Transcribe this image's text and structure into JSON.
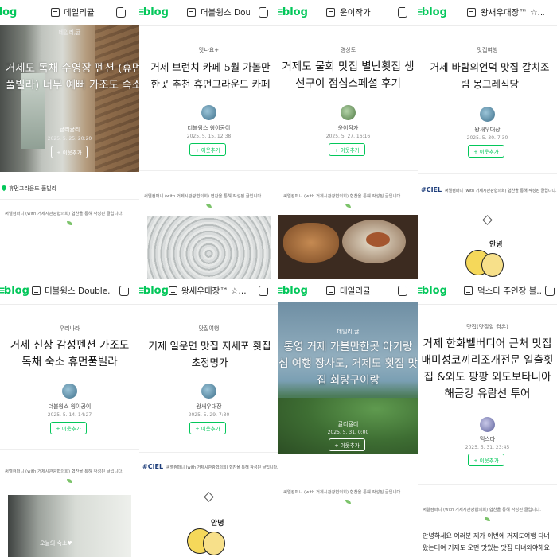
{
  "tiles": [
    {
      "blog_name": "데일리귤",
      "category": "데일리,귤",
      "title_line1": "거제도 독채 수영장 펜션 (휴먼",
      "title_line2": "풀빌라) 너무 예뻐 가조도 숙소",
      "author": "귤리귤리",
      "date": "2025. 5. 25. 20:20",
      "neighbor": "+ 이웃추가",
      "location": "휴먼그라운드 풀빌라",
      "note": "써엘컴퍼니 (with 거제시관광협의회) 협찬을 통해 작성된 글입니다."
    },
    {
      "blog_name": "더블윙스 Double...",
      "category": "맛나요+",
      "title_line1": "거제 브런치 카페 5월 가볼만",
      "title_line2": "한곳 추천 휴먼그라운드 카페",
      "author": "더블윙스 윙이공이",
      "date": "2025. 5. 15. 12:38",
      "neighbor": "+ 이웃추가",
      "note": "써엘컴퍼니 (with 거제시관광협의회) 협찬을 통해 작성된 글입니다."
    },
    {
      "blog_name": "윤이작가",
      "category": "경상도",
      "title_line1": "거제도 물회 맛집 별난횟집 생",
      "title_line2": "선구이 점심스페셜 후기",
      "author": "윤이작가",
      "date": "2025. 5. 27. 16:16",
      "neighbor": "+ 이웃추가",
      "note": "써엘컴퍼니 (with 거제시관광협의회) 협찬을 통해 작성된 글입니다."
    },
    {
      "blog_name": "왕새우대장™ ☆...",
      "category": "맛집여행",
      "title_line1": "거제 바람의언덕 맛집 갈치조",
      "title_line2": "림 몽그레식당",
      "author": "왕새우대장",
      "date": "2025. 5. 30. 7:30",
      "neighbor": "+ 이웃추가",
      "ciel": "#CIEL",
      "ciel_note": "써엘컴퍼니 (with 거제시관광협의회) 협찬을 통해 작성된 글입니다.",
      "sticker_text": "안녕"
    },
    {
      "blog_name": "더블윙스 Double...",
      "category": "우리나라",
      "title_line1": "거제 신상 감성펜션 가조도",
      "title_line2": "독채 숙소 휴먼풀빌라",
      "author": "더블윙스 윙이공이",
      "date": "2025. 5. 14. 14:27",
      "neighbor": "+ 이웃추가",
      "note": "써엘컴퍼니 (with 거제시관광협의회) 협찬을 통해 작성된 글입니다.",
      "photo_caption": "오늘의 숙소♥"
    },
    {
      "blog_name": "왕새우대장™ ☆...",
      "category": "맛집여행",
      "title_line1": "거제 일운면 맛집 지세포 횟집",
      "title_line2": "초정명가",
      "author": "왕새우대장",
      "date": "2025. 5. 29. 7:30",
      "neighbor": "+ 이웃추가",
      "ciel": "#CIEL",
      "ciel_note": "써엘컴퍼니 (with 거제시관광협의회) 협찬을 통해 작성된 글입니다.",
      "sticker_text": "안녕"
    },
    {
      "blog_name": "데일리귤",
      "category": "데일리,귤",
      "title_line1": "통영 거제 가볼만한곳 아기랑",
      "title_line2": "섬 여행 장사도, 거제도 횟집 맛",
      "title_line3": "집 회랑구이랑",
      "author": "귤리귤리",
      "date": "2025. 5. 31. 0:00",
      "neighbor": "+ 이웃추가",
      "note": "써엘컴퍼니 (with 거제시관광협의회) 협찬을 통해 작성된 글입니다."
    },
    {
      "blog_name": "먹스타 주인장 블...",
      "category": "맛집(맛잘알 컴온)",
      "title_line1": "거제 한화벨버디어 근처 맛집",
      "title_line2": "매미성코끼리조개전문 일출횟",
      "title_line3": "집 &외도 팡팡 외도보타니아",
      "title_line4": "해금강 유람선 투어",
      "author": "먹스타",
      "date": "2025. 5. 31. 23:45",
      "neighbor": "+ 이웃추가",
      "note": "써엘컴퍼니 (with 거제시관광협의회) 협찬을 통해 작성된 글입니다.",
      "body_line1": "안녕하세요 여러분 제가 이번에 거제도여행 다녀",
      "body_line2": "왔는데여 거제도 오면 맛있는 맛집 다녀와야해요"
    }
  ],
  "logo_text": "blog",
  "colors": {
    "brand_green": "#03c75a",
    "ciel_navy": "#1d3d7a"
  }
}
